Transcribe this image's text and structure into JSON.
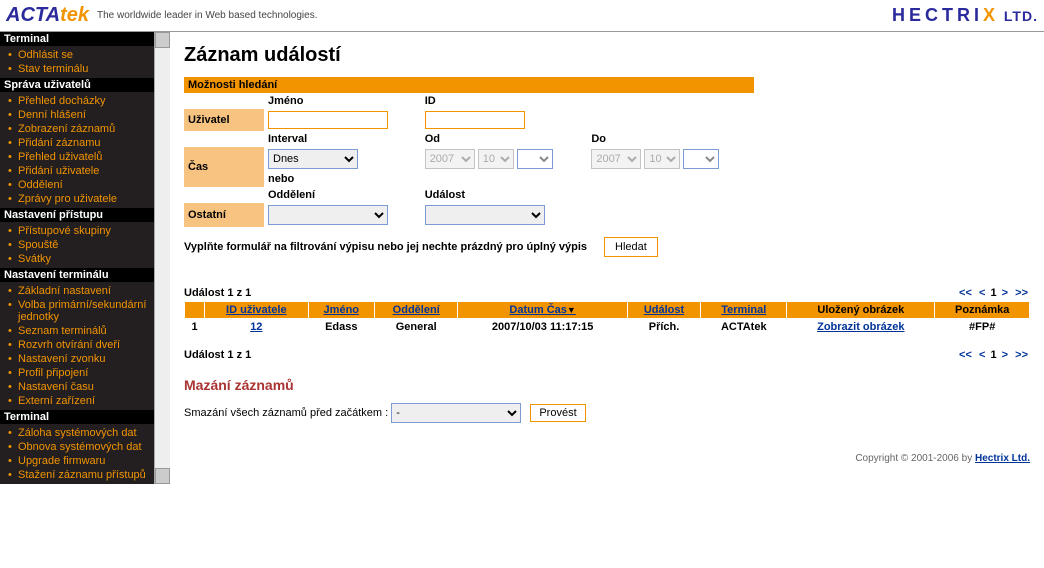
{
  "header": {
    "logo_a": "ACTA",
    "logo_b": "tek",
    "tagline": "The worldwide leader in Web based technologies.",
    "hectrix_a": "HECTRI",
    "hectrix_x": "X",
    "hectrix_ltd": " LTD."
  },
  "sidebar": {
    "sections": [
      {
        "title": "Terminal",
        "items": [
          "Odhlásit se",
          "Stav terminálu"
        ]
      },
      {
        "title": "Správa uživatelů",
        "items": [
          "Přehled docházky",
          "Denní hlášení",
          "Zobrazení záznamů",
          "Přidání záznamu",
          "Přehled uživatelů",
          "Přidání uživatele",
          "Oddělení",
          "Zprávy pro uživatele"
        ]
      },
      {
        "title": "Nastavení přístupu",
        "items": [
          "Přístupové skupiny",
          "Spouště",
          "Svátky"
        ]
      },
      {
        "title": "Nastavení terminálu",
        "items": [
          "Základní nastavení",
          "Volba primární/sekundární jednotky",
          "Seznam terminálů",
          "Rozvrh otvírání dveří",
          "Nastavení zvonku",
          "Profil připojení",
          "Nastavení času",
          "Externí zařízení"
        ]
      },
      {
        "title": "Terminal",
        "items": [
          "Záloha systémových dat",
          "Obnova systémových dat",
          "Upgrade firmwaru",
          "Stažení záznamu přístupů"
        ]
      }
    ]
  },
  "main": {
    "title": "Záznam událostí",
    "search_head": "Možnosti hledání",
    "row_user": "Uživatel",
    "row_time": "Čas",
    "row_other": "Ostatní",
    "col_name": "Jméno",
    "col_id": "ID",
    "col_interval": "Interval",
    "col_from": "Od",
    "col_to": "Do",
    "col_dep": "Oddělení",
    "col_event": "Událost",
    "interval_value": "Dnes",
    "nebo": "nebo",
    "year_value": "2007",
    "month_value": "10",
    "hint": "Vyplňte formulář na filtrování výpisu nebo jej nechte prázdný pro úplný výpis",
    "search_btn": "Hledat"
  },
  "results": {
    "summary": "Událost 1 z 1",
    "pager_first": "<<",
    "pager_prev": "<",
    "pager_cur": "1",
    "pager_next": ">",
    "pager_last": ">>",
    "cols": {
      "id": "ID uživatele",
      "name": "Jméno",
      "dep": "Oddělení",
      "datetime": "Datum Čas",
      "event": "Událost",
      "terminal": "Terminal",
      "image": "Uložený obrázek",
      "note": "Poznámka"
    },
    "row": {
      "idx": "1",
      "uid": "12",
      "name": "Edass",
      "dep": "General",
      "datetime": "2007/10/03 11:17:15",
      "event": "Přích.",
      "terminal": "ACTAtek",
      "image": "Zobrazit obrázek",
      "note": "#FP#"
    }
  },
  "delete": {
    "title": "Mazání záznamů",
    "label": "Smazání všech záznamů před začátkem :",
    "value": "-",
    "btn": "Provést"
  },
  "footer": {
    "text": "Copyright © 2001-2006 by ",
    "link": "Hectrix Ltd."
  }
}
